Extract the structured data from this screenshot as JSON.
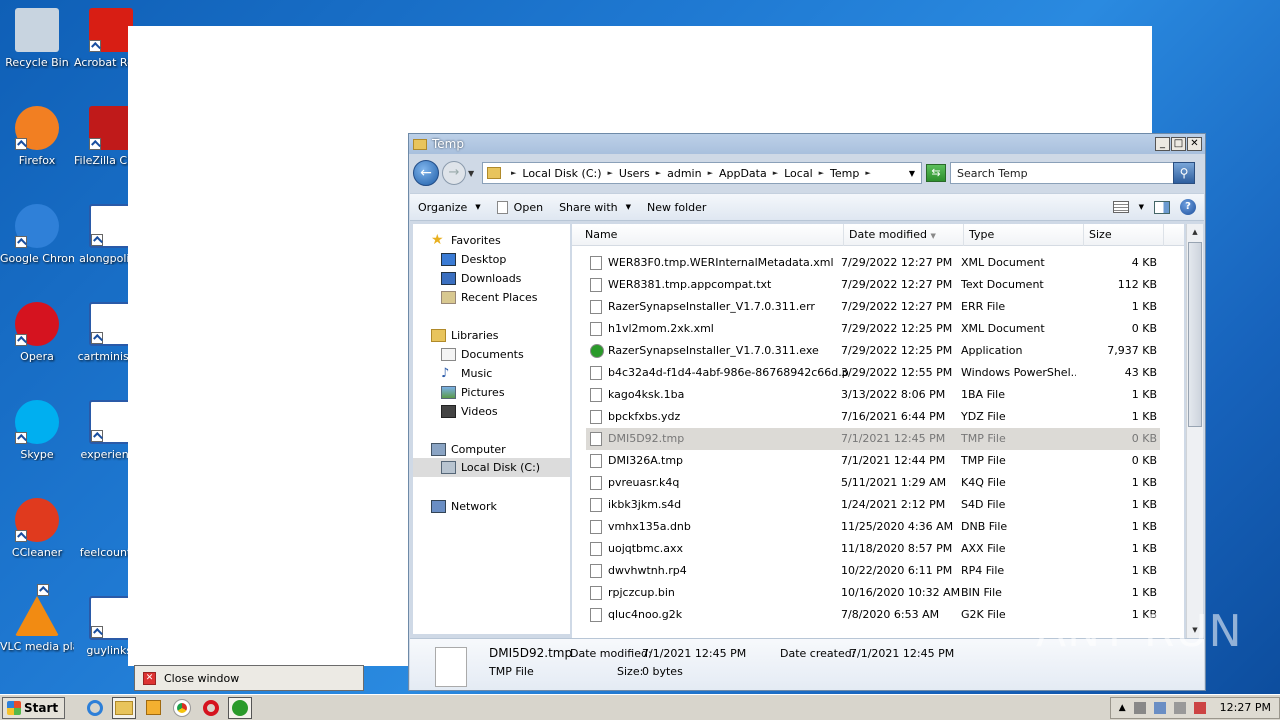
{
  "desktop_icons": [
    {
      "label": "Recycle Bin",
      "icon": "recycle-bin-icon",
      "color": "#c8d4e0"
    },
    {
      "label": "Acrobat Reader DC",
      "icon": "acrobat-icon",
      "color": "#d81e14"
    },
    {
      "label": "Firefox",
      "icon": "firefox-icon",
      "color": "#f27f22"
    },
    {
      "label": "FileZilla Client",
      "icon": "filezilla-icon",
      "color": "#c01a1a"
    },
    {
      "label": "Google Chrome",
      "icon": "chrome-icon",
      "color": "#2f80d8"
    },
    {
      "label": "alongpolitic",
      "icon": "word-doc-icon",
      "color": "#2a5aa8"
    },
    {
      "label": "Opera",
      "icon": "opera-icon",
      "color": "#d5131f"
    },
    {
      "label": "cartminister",
      "icon": "word-doc-icon",
      "color": "#2a5aa8"
    },
    {
      "label": "Skype",
      "icon": "skype-icon",
      "color": "#00aff0"
    },
    {
      "label": "experience",
      "icon": "word-doc-icon",
      "color": "#2a5aa8"
    },
    {
      "label": "CCleaner",
      "icon": "ccleaner-icon",
      "color": "#e03a1e"
    },
    {
      "label": "feelcountry",
      "icon": "blank-icon",
      "color": "#1f79d2"
    },
    {
      "label": "VLC media player",
      "icon": "vlc-icon",
      "color": "#f28b12"
    },
    {
      "label": "guylinks.",
      "icon": "word-doc-icon",
      "color": "#2a5aa8"
    }
  ],
  "close_window": {
    "label": "Close window"
  },
  "explorer": {
    "title": "Temp",
    "breadcrumbs": [
      "Local Disk (C:)",
      "Users",
      "admin",
      "AppData",
      "Local",
      "Temp"
    ],
    "search_placeholder": "Search Temp",
    "toolbar": {
      "organize": "Organize",
      "open": "Open",
      "share_with": "Share with",
      "new_folder": "New folder"
    },
    "nav": {
      "favorites": "Favorites",
      "desktop": "Desktop",
      "downloads": "Downloads",
      "recent": "Recent Places",
      "libraries": "Libraries",
      "documents": "Documents",
      "music": "Music",
      "pictures": "Pictures",
      "videos": "Videos",
      "computer": "Computer",
      "local_disk": "Local Disk (C:)",
      "network": "Network"
    },
    "columns": {
      "name": "Name",
      "date": "Date modified",
      "type": "Type",
      "size": "Size"
    },
    "files": [
      {
        "name": "WER83F0.tmp.WERInternalMetadata.xml",
        "date": "7/29/2022 12:27 PM",
        "type": "XML Document",
        "size": "4 KB"
      },
      {
        "name": "WER8381.tmp.appcompat.txt",
        "date": "7/29/2022 12:27 PM",
        "type": "Text Document",
        "size": "112 KB"
      },
      {
        "name": "RazerSynapseInstaller_V1.7.0.311.err",
        "date": "7/29/2022 12:27 PM",
        "type": "ERR File",
        "size": "1 KB"
      },
      {
        "name": "h1vl2mom.2xk.xml",
        "date": "7/29/2022 12:25 PM",
        "type": "XML Document",
        "size": "0 KB"
      },
      {
        "name": "RazerSynapseInstaller_V1.7.0.311.exe",
        "date": "7/29/2022 12:25 PM",
        "type": "Application",
        "size": "7,937 KB"
      },
      {
        "name": "b4c32a4d-f1d4-4abf-986e-86768942c66d.ps1",
        "date": "3/29/2022 12:55 PM",
        "type": "Windows PowerShel...",
        "size": "43 KB"
      },
      {
        "name": "kago4ksk.1ba",
        "date": "3/13/2022 8:06 PM",
        "type": "1BA File",
        "size": "1 KB"
      },
      {
        "name": "bpckfxbs.ydz",
        "date": "7/16/2021 6:44 PM",
        "type": "YDZ File",
        "size": "1 KB"
      },
      {
        "name": "DMI5D92.tmp",
        "date": "7/1/2021 12:45 PM",
        "type": "TMP File",
        "size": "0 KB",
        "selected": true
      },
      {
        "name": "DMI326A.tmp",
        "date": "7/1/2021 12:44 PM",
        "type": "TMP File",
        "size": "0 KB"
      },
      {
        "name": "pvreuasr.k4q",
        "date": "5/11/2021 1:29 AM",
        "type": "K4Q File",
        "size": "1 KB"
      },
      {
        "name": "ikbk3jkm.s4d",
        "date": "1/24/2021 2:12 PM",
        "type": "S4D File",
        "size": "1 KB"
      },
      {
        "name": "vmhx135a.dnb",
        "date": "11/25/2020 4:36 AM",
        "type": "DNB File",
        "size": "1 KB"
      },
      {
        "name": "uojqtbmc.axx",
        "date": "11/18/2020 8:57 PM",
        "type": "AXX File",
        "size": "1 KB"
      },
      {
        "name": "dwvhwtnh.rp4",
        "date": "10/22/2020 6:11 PM",
        "type": "RP4 File",
        "size": "1 KB"
      },
      {
        "name": "rpjczcup.bin",
        "date": "10/16/2020 10:32 AM",
        "type": "BIN File",
        "size": "1 KB"
      },
      {
        "name": "qluc4noo.g2k",
        "date": "7/8/2020 6:53 AM",
        "type": "G2K File",
        "size": "1 KB"
      }
    ],
    "details": {
      "name": "DMI5D92.tmp",
      "type": "TMP File",
      "modified_label": "Date modified:",
      "modified": "7/1/2021 12:45 PM",
      "created_label": "Date created:",
      "created": "7/1/2021 12:45 PM",
      "size_label": "Size:",
      "size": "0 bytes"
    }
  },
  "taskbar": {
    "start": "Start",
    "clock": "12:27 PM"
  },
  "watermark": "ANY RUN"
}
